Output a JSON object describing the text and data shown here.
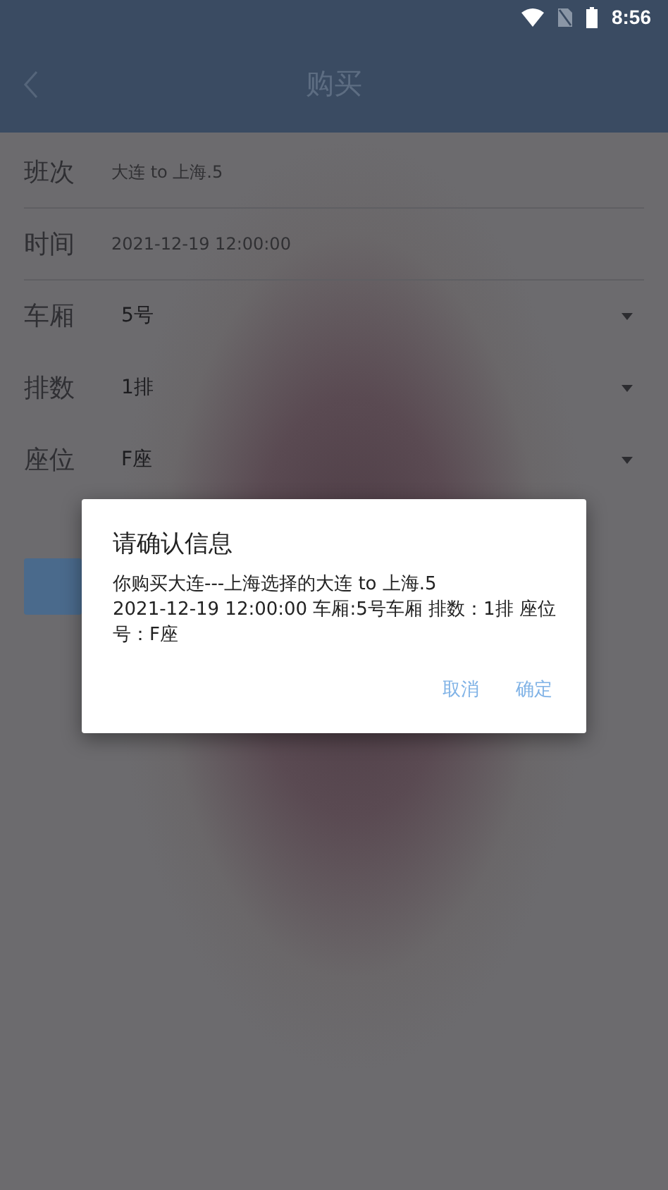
{
  "status_bar": {
    "time": "8:56"
  },
  "header": {
    "title": "购买"
  },
  "form": {
    "rows": [
      {
        "label": "班次",
        "value": "大连 to 上海.5",
        "kind": "text"
      },
      {
        "label": "时间",
        "value": "2021-12-19 12:00:00",
        "kind": "text"
      },
      {
        "label": "车厢",
        "value": "5号",
        "kind": "dropdown"
      },
      {
        "label": "排数",
        "value": "1排",
        "kind": "dropdown"
      },
      {
        "label": "座位",
        "value": "F座",
        "kind": "dropdown"
      }
    ]
  },
  "dialog": {
    "title": "请确认信息",
    "message": "你购买大连---上海选择的大连 to 上海.5\n2021-12-19 12:00:00 车厢:5号车厢 排数：1排 座位号：F座",
    "buttons": [
      "取消",
      "确定"
    ]
  }
}
